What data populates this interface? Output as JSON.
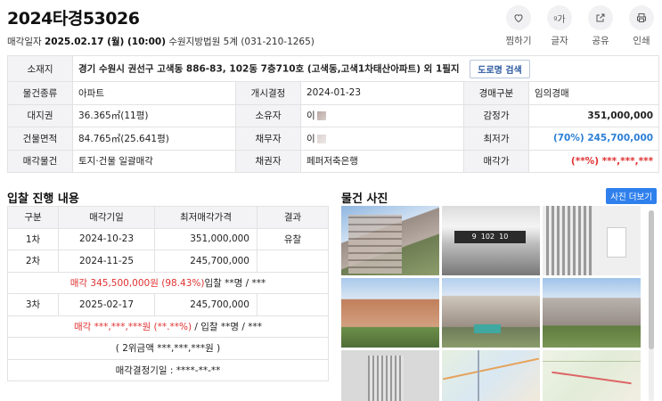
{
  "case_title": "2024타경53026",
  "sale": {
    "label": "매각일자",
    "date": "2025.02.17 (월) (10:00)",
    "court": "수원지방법원 5계 (031-210-1265)"
  },
  "actions": [
    {
      "label": "찜하기",
      "icon": "heart-icon"
    },
    {
      "label": "글자",
      "icon": "font-size-icon"
    },
    {
      "label": "공유",
      "icon": "share-icon"
    },
    {
      "label": "인쇄",
      "icon": "print-icon"
    }
  ],
  "font_icon_glyph": "ᵍ가",
  "info": {
    "location_label": "소재지",
    "location": "경기 수원시 권선구 고색동 886-83, 102동 7층710호 (고색동,고색1차태산아파트) 외 1필지",
    "road_btn": "도로명 검색",
    "type_label": "물건종류",
    "type": "아파트",
    "start_label": "개시결정",
    "start": "2024-01-23",
    "auction_type_label": "경매구분",
    "auction_type": "임의경매",
    "land_label": "대지권",
    "land": "36.365㎡(11평)",
    "owner_label": "소유자",
    "owner": "이",
    "appraisal_label": "감정가",
    "appraisal": "351,000,000",
    "area_label": "건물면적",
    "area": "84.765㎡(25.641평)",
    "debtor_label": "채무자",
    "debtor": "이",
    "min_label": "최저가",
    "min": "(70%) 245,700,000",
    "item_label": "매각물건",
    "item": "토지·건물 일괄매각",
    "creditor_label": "채권자",
    "creditor": "페퍼저축은행",
    "price_label": "매각가",
    "price": "(**%) ***,***,***"
  },
  "bid": {
    "title": "입찰 진행 내용",
    "headers": [
      "구분",
      "매각기일",
      "최저매각가격",
      "결과"
    ],
    "r1": {
      "round": "1차",
      "date": "2024-10-23",
      "price": "351,000,000",
      "result": "유찰"
    },
    "r2": {
      "round": "2차",
      "date": "2024-11-25",
      "price": "245,700,000",
      "result": ""
    },
    "r2_note_red": "매각 345,500,000원 (98.43%)",
    "r2_note_rest": "입찰 **명 / ***",
    "r3": {
      "round": "3차",
      "date": "2025-02-17",
      "price": "245,700,000",
      "result": ""
    },
    "r3_note_red": "매각 ***,***,***원 (**.**%)",
    "r3_note_rest": " / 입찰 **명 / ***",
    "second_bid": "( 2위금액 ***,***,***원 )",
    "decision": "매각결정기일 : ****-**-**"
  },
  "photos": {
    "title": "물건 사진",
    "more": "사진 더보기",
    "sign": "9  102  10"
  }
}
